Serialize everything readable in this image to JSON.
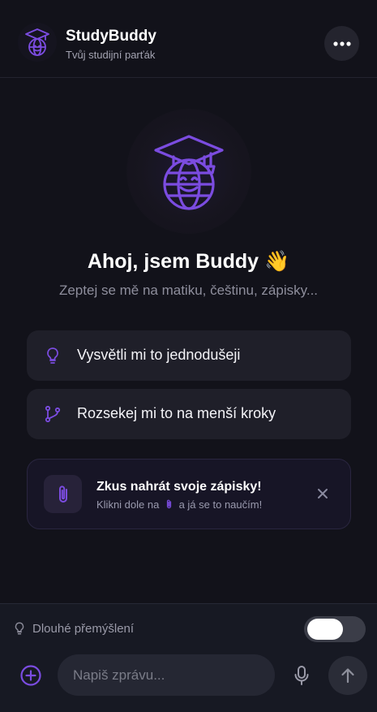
{
  "header": {
    "title": "StudyBuddy",
    "subtitle": "Tvůj studijní parťák",
    "logo_icon": "graduation-globe-icon",
    "more_icon": "more-dots-icon"
  },
  "hero": {
    "icon": "smiling-globe-graduation-cap-icon",
    "greeting": "Ahoj, jsem Buddy 👋",
    "subtitle": "Zeptej se mě na matiku, češtinu, zápisky..."
  },
  "suggestions": [
    {
      "label": "Vysvětli mi to jednodušeji",
      "icon": "lightbulb-icon"
    },
    {
      "label": "Rozsekej mi to na menší kroky",
      "icon": "branch-icon"
    }
  ],
  "tip": {
    "title": "Zkus nahrát svoje zápisky!",
    "text_before": "Klikni dole na",
    "text_after": "a já se to naučím!",
    "icon": "paperclip-icon",
    "close_icon": "close-icon"
  },
  "composer": {
    "thinking_label": "Dlouhé přemýšlení",
    "thinking_enabled": false,
    "input_value": "",
    "input_placeholder": "Napiš zprávu...",
    "add_icon": "plus-circle-icon",
    "mic_icon": "microphone-icon",
    "send_icon": "arrow-up-icon"
  },
  "colors": {
    "accent": "#7b4ce0",
    "background": "#12121a",
    "card": "#1f1f29"
  }
}
